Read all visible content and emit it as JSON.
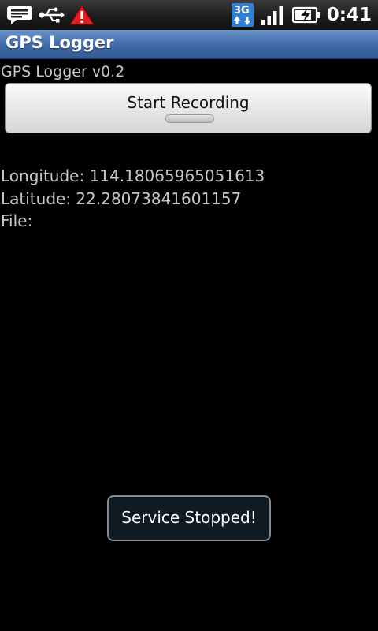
{
  "status_bar": {
    "clock": "0:41",
    "network_type": "3G",
    "icons": [
      "message-icon",
      "usb-icon",
      "warning-icon",
      "3g-data-icon",
      "signal-icon",
      "battery-charging-icon"
    ]
  },
  "app": {
    "title": "GPS Logger",
    "version": "GPS Logger v0.2"
  },
  "controls": {
    "record_button_label": "Start Recording"
  },
  "location": {
    "longitude_label": "Longitude:",
    "longitude_value": "114.18065965051613",
    "latitude_label": "Latitude:",
    "latitude_value": "22.28073841601157",
    "file_label": "File:",
    "file_value": ""
  },
  "toast": {
    "message": "Service Stopped!"
  },
  "colors": {
    "title_bar": "#3f6aa6",
    "background": "#000000",
    "toast_bg": "#0f1a22",
    "warning": "#e02020",
    "network_badge": "#2f7fd6"
  }
}
